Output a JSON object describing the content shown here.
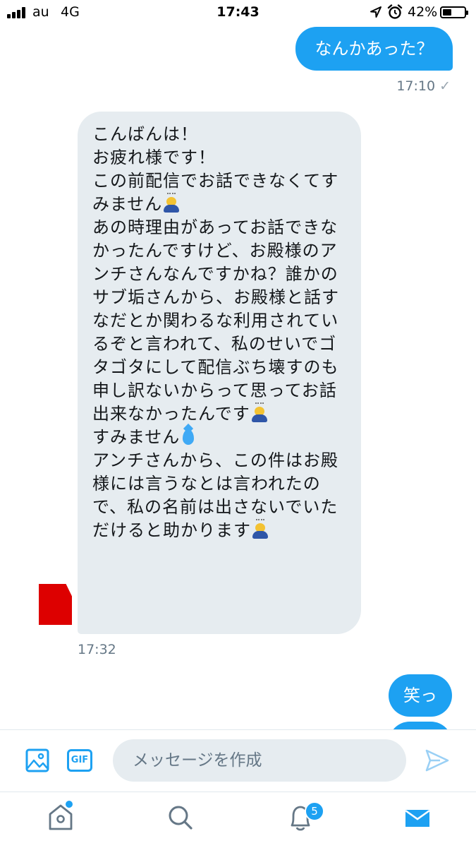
{
  "status_bar": {
    "carrier": "au",
    "network": "4G",
    "time": "17:43",
    "battery_percent": "42%",
    "battery_level": 0.42,
    "icons": [
      "signal-icon",
      "location-icon",
      "alarm-icon",
      "battery-icon"
    ]
  },
  "messages": {
    "outgoing_1": {
      "text": "なんかあった？",
      "time": "17:10",
      "status_icon": "✓"
    },
    "incoming_1": {
      "lines": [
        "こんばんは！",
        "お疲れ様です！",
        "",
        "この前配信でお話できなくてす",
        "みません",
        "あの時理由があってお話できな",
        "かったんですけど、お殿様のア",
        "ンチさんなんですかね？誰かの",
        "サブ垢さんから、お殿様と話す",
        "なだとか関わるな利用されてい",
        "るぞと言われて、私のせいでゴ",
        "タゴタにして配信ぶち壊すのも",
        "申し訳ないからって思ってお話",
        "出来なかったんです",
        "すみません",
        "",
        "アンチさんから、この件はお殿",
        "様には言うなとは言われたの",
        "で、私の名前は出さないでいた",
        "だけると助かります"
      ],
      "time": "17:32"
    },
    "outgoing_2": {
      "text": "笑っ"
    }
  },
  "composer": {
    "placeholder": "メッセージを作成",
    "gif_label": "GIF"
  },
  "tab_bar": {
    "notifications_badge": "5"
  },
  "colors": {
    "accent": "#1da1f2",
    "incoming_bubble": "#e6ecf0",
    "meta_text": "#657786"
  }
}
